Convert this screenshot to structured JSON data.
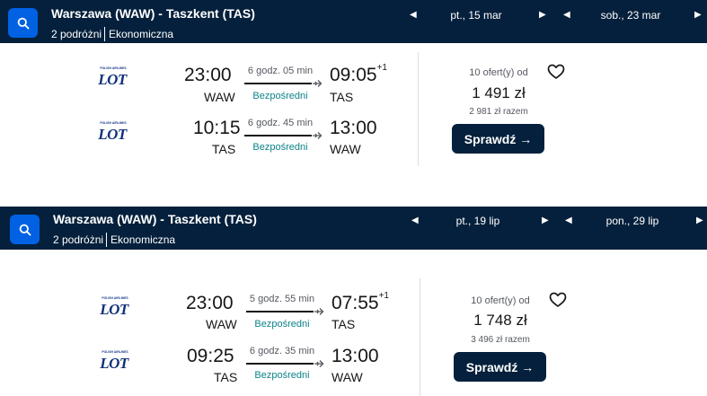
{
  "searches": [
    {
      "route": "Warszawa (WAW) - Taszkent (TAS)",
      "travellers": "2 podróżni",
      "cabin": "Ekonomiczna",
      "depart_date": "pt., 15 mar",
      "return_date": "sob., 23 mar",
      "result": {
        "airline": "LOT",
        "airline_tagline": "POLISH AIRLINES",
        "outbound": {
          "dep_time": "23:00",
          "arr_time": "09:05",
          "day_offset": "+1",
          "from": "WAW",
          "to": "TAS",
          "duration": "6 godz. 05 min",
          "stops": "Bezpośredni"
        },
        "inbound": {
          "dep_time": "10:15",
          "arr_time": "13:00",
          "day_offset": "",
          "from": "TAS",
          "to": "WAW",
          "duration": "6 godz. 45 min",
          "stops": "Bezpośredni"
        },
        "offers": "10 ofert(y) od",
        "price": "1 491 zł",
        "total": "2 981 zł razem",
        "button": "Sprawdź →"
      }
    },
    {
      "route": "Warszawa (WAW) - Taszkent (TAS)",
      "travellers": "2 podróżni",
      "cabin": "Ekonomiczna",
      "depart_date": "pt., 19 lip",
      "return_date": "pon., 29 lip",
      "result": {
        "airline": "LOT",
        "airline_tagline": "POLISH AIRLINES",
        "outbound": {
          "dep_time": "23:00",
          "arr_time": "07:55",
          "day_offset": "+1",
          "from": "WAW",
          "to": "TAS",
          "duration": "5 godz. 55 min",
          "stops": "Bezpośredni"
        },
        "inbound": {
          "dep_time": "09:25",
          "arr_time": "13:00",
          "day_offset": "",
          "from": "TAS",
          "to": "WAW",
          "duration": "6 godz. 35 min",
          "stops": "Bezpośredni"
        },
        "offers": "10 ofert(y) od",
        "price": "1 748 zł",
        "total": "3 496 zł razem",
        "button": "Sprawdź →"
      }
    }
  ],
  "icons": {
    "search": "search-icon",
    "prev": "chevron-left-icon",
    "next": "chevron-right-icon",
    "save": "heart-icon",
    "plane": "plane-icon",
    "logo": "lot-logo"
  },
  "colors": {
    "header_bg": "#05203c",
    "search_button": "#0062e3",
    "direct": "#0c838a"
  }
}
